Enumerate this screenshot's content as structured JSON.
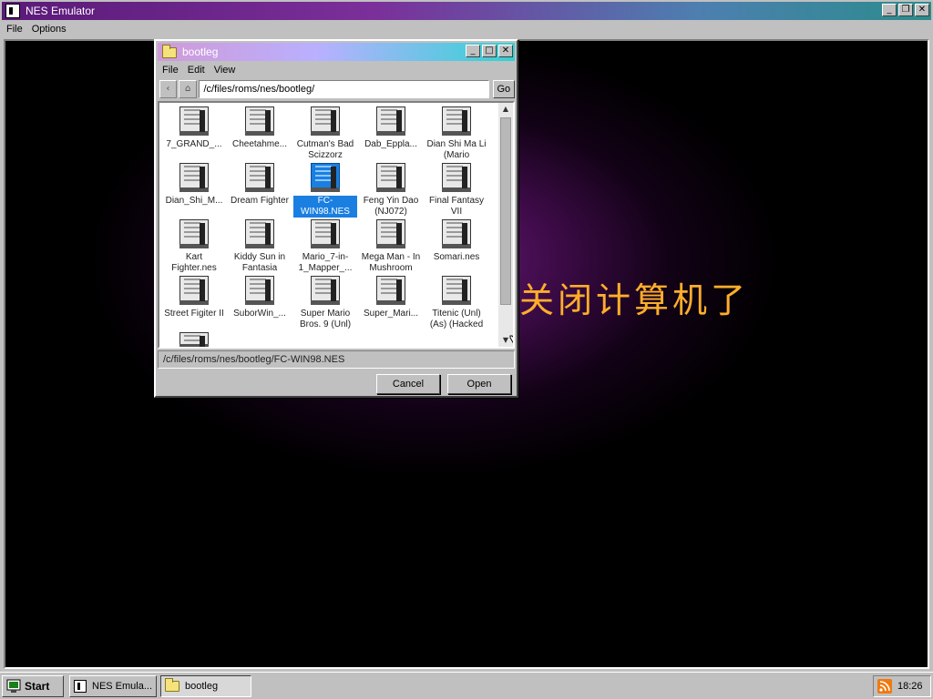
{
  "main_window": {
    "title": "NES Emulator",
    "menu": [
      "File",
      "Options"
    ],
    "window_buttons": {
      "minimize": "_",
      "restore": "❐",
      "close": "✕"
    }
  },
  "emulator_screen": {
    "text": "关闭计算机了",
    "text_color": "#ffae2a"
  },
  "dialog": {
    "title": "bootleg",
    "menu": [
      "File",
      "Edit",
      "View"
    ],
    "nav": {
      "back": "‹",
      "home": "⌂",
      "go": "Go"
    },
    "path": "/c/files/roms/nes/bootleg/",
    "files": [
      {
        "name": "7_GRAND_...",
        "selected": false
      },
      {
        "name": "Cheetahme...",
        "selected": false
      },
      {
        "name": "Cutman's Bad Scizzorz",
        "selected": false
      },
      {
        "name": "Dab_Eppla...",
        "selected": false
      },
      {
        "name": "Dian Shi Ma Li (Mario",
        "selected": false
      },
      {
        "name": "Dian_Shi_M...",
        "selected": false
      },
      {
        "name": "Dream Fighter",
        "selected": false
      },
      {
        "name": "FC-WIN98.NES",
        "selected": true
      },
      {
        "name": "Feng Yin Dao (NJ072)",
        "selected": false
      },
      {
        "name": "Final Fantasy VII",
        "selected": false
      },
      {
        "name": "Kart Fighter.nes",
        "selected": false
      },
      {
        "name": "Kiddy Sun in Fantasia",
        "selected": false
      },
      {
        "name": "Mario_7-in-1_Mapper_...",
        "selected": false
      },
      {
        "name": "Mega Man - In Mushroom",
        "selected": false
      },
      {
        "name": "Somari.nes",
        "selected": false
      },
      {
        "name": "Street Figiter II",
        "selected": false
      },
      {
        "name": "SuborWin_...",
        "selected": false
      },
      {
        "name": "Super Mario Bros. 9 (Unl)",
        "selected": false
      },
      {
        "name": "Super_Mari...",
        "selected": false
      },
      {
        "name": "Titenic (Unl) (As) (Hacked",
        "selected": false
      },
      {
        "name": "",
        "selected": false
      }
    ],
    "status_path": "/c/files/roms/nes/bootleg/FC-WIN98.NES",
    "buttons": {
      "cancel": "Cancel",
      "open": "Open"
    },
    "selection_color": "#1a7fe0"
  },
  "taskbar": {
    "start_label": "Start",
    "tasks": [
      {
        "label": "NES Emula...",
        "icon": "nes-app-icon"
      },
      {
        "label": "bootleg",
        "icon": "folder-icon"
      }
    ],
    "clock": "18:26",
    "tray_icon": "rss-icon"
  }
}
